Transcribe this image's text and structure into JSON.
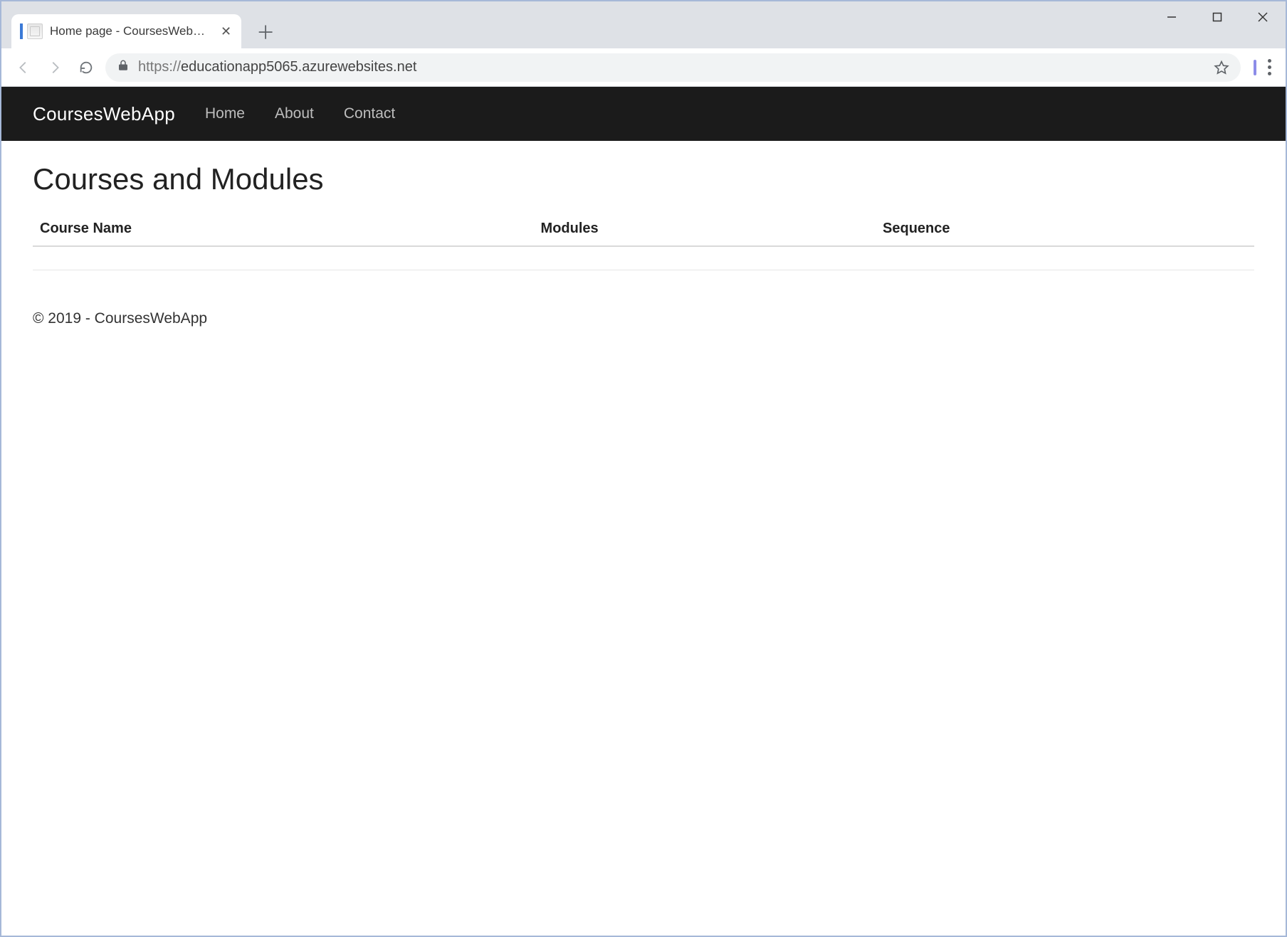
{
  "browser": {
    "tab_title": "Home page - CoursesWebApp",
    "url_display": "https://educationapp5065.azurewebsites.net",
    "url_protocol": "https://",
    "url_host": "educationapp5065.azurewebsites.net"
  },
  "navbar": {
    "brand": "CoursesWebApp",
    "links": [
      {
        "label": "Home"
      },
      {
        "label": "About"
      },
      {
        "label": "Contact"
      }
    ]
  },
  "page": {
    "title": "Courses and Modules",
    "table_headers": {
      "course_name": "Course Name",
      "modules": "Modules",
      "sequence": "Sequence"
    },
    "rows": []
  },
  "footer": {
    "text": "© 2019 - CoursesWebApp"
  }
}
